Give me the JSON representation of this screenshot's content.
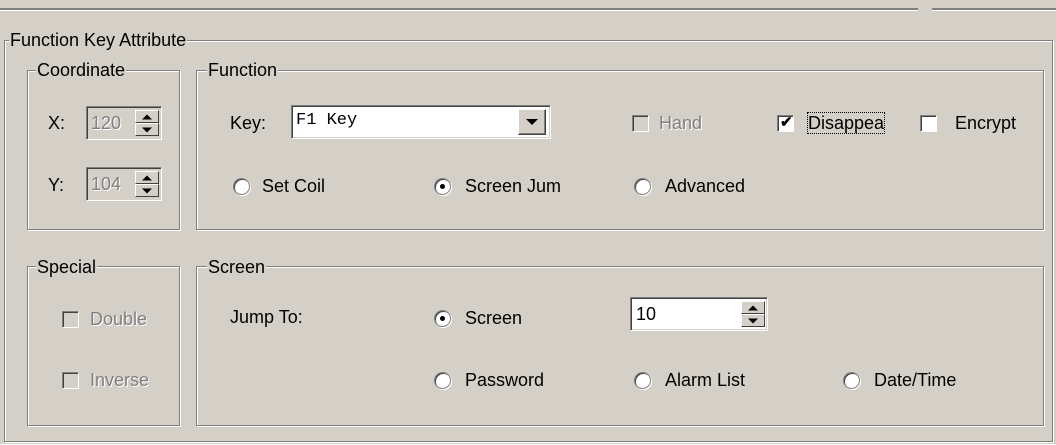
{
  "panel": {
    "title": "Function Key Attribute"
  },
  "coordinate": {
    "title": "Coordinate",
    "x_label": "X:",
    "x_value": "120",
    "y_label": "Y:",
    "y_value": "104"
  },
  "function": {
    "title": "Function",
    "key_label": "Key:",
    "key_selected": "F1 Key",
    "hand_label": "Hand",
    "hand_checked": false,
    "disappear_label": "Disappea",
    "disappear_checked": true,
    "encrypt_label": "Encrypt",
    "encrypt_checked": false,
    "modes": [
      {
        "label": "Set Coil",
        "selected": false
      },
      {
        "label": "Screen Jum",
        "selected": true
      },
      {
        "label": "Advanced",
        "selected": false
      }
    ]
  },
  "special": {
    "title": "Special",
    "double_label": "Double",
    "inverse_label": "Inverse"
  },
  "screen": {
    "title": "Screen",
    "jump_to_label": "Jump To:",
    "options": [
      {
        "label": "Screen",
        "selected": true
      },
      {
        "label": "Password",
        "selected": false
      },
      {
        "label": "Alarm List",
        "selected": false
      },
      {
        "label": "Date/Time",
        "selected": false
      }
    ],
    "screen_number": "10"
  },
  "icons": [
    "spin-up-icon",
    "spin-down-icon",
    "dropdown-arrow-icon",
    "checkmark-icon"
  ]
}
